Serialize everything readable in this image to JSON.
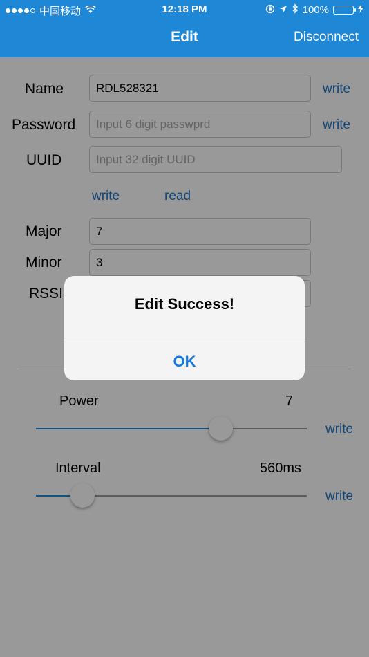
{
  "status_bar": {
    "carrier": "中国移动",
    "time": "12:18 PM",
    "battery": "100%",
    "signal_icon": "signal-dots-icon",
    "wifi_icon": "wifi-icon"
  },
  "nav": {
    "title": "Edit",
    "right_button": "Disconnect"
  },
  "form": {
    "name": {
      "label": "Name",
      "value": "RDL528321",
      "action": "write"
    },
    "password": {
      "label": "Password",
      "placeholder": "Input 6 digit passwprd",
      "action": "write"
    },
    "uuid": {
      "label": "UUID",
      "placeholder": "Input 32 digit UUID",
      "write": "write",
      "read": "read"
    },
    "major": {
      "label": "Major",
      "value": "7"
    },
    "minor": {
      "label": "Minor",
      "value": "3"
    },
    "rssi": {
      "label": "RSSI"
    }
  },
  "sliders": {
    "power": {
      "label": "Power",
      "value": "7",
      "action": "write",
      "fraction": 0.68
    },
    "interval": {
      "label": "Interval",
      "value": "560ms",
      "action": "write",
      "fraction": 0.17
    }
  },
  "alert": {
    "message": "Edit Success!",
    "ok": "OK"
  },
  "colors": {
    "nav_bg": "#1f88d6",
    "link": "#1e73c8",
    "alert_button": "#1478e0"
  }
}
